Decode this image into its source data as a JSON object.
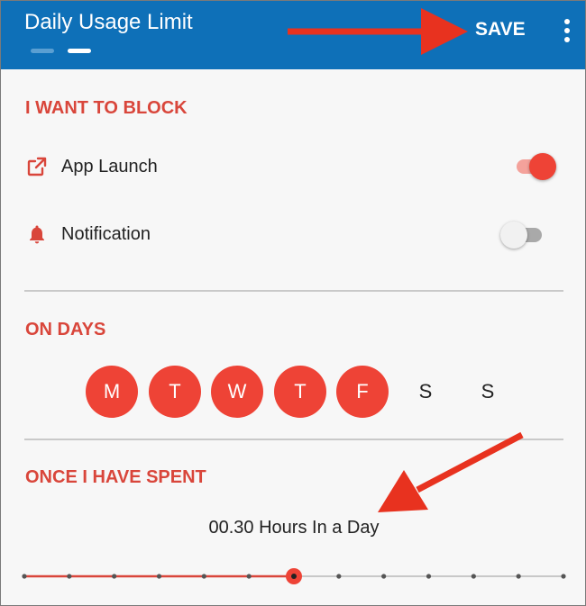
{
  "header": {
    "title": "Daily Usage Limit",
    "save_label": "SAVE",
    "page_indicator": {
      "count": 2,
      "active_index": 1
    },
    "menu_icon": "more-vert-icon"
  },
  "block_section": {
    "heading": "I WANT TO BLOCK",
    "options": [
      {
        "label": "App Launch",
        "icon": "open-in-new-icon",
        "enabled": true
      },
      {
        "label": "Notification",
        "icon": "bell-icon",
        "enabled": false
      }
    ]
  },
  "days_section": {
    "heading": "ON DAYS",
    "days": [
      {
        "label": "M",
        "selected": true
      },
      {
        "label": "T",
        "selected": true
      },
      {
        "label": "W",
        "selected": true
      },
      {
        "label": "T",
        "selected": true
      },
      {
        "label": "F",
        "selected": true
      },
      {
        "label": "S",
        "selected": false
      },
      {
        "label": "S",
        "selected": false
      }
    ]
  },
  "spent_section": {
    "heading": "ONCE I HAVE SPENT",
    "value_text": "00.30 Hours In a Day",
    "slider": {
      "steps": 13,
      "selected_step": 6
    }
  },
  "colors": {
    "appbar": "#0e70b8",
    "accent": "#ee4336",
    "heading": "#d9463b",
    "annotation_arrow": "#e8321f"
  }
}
